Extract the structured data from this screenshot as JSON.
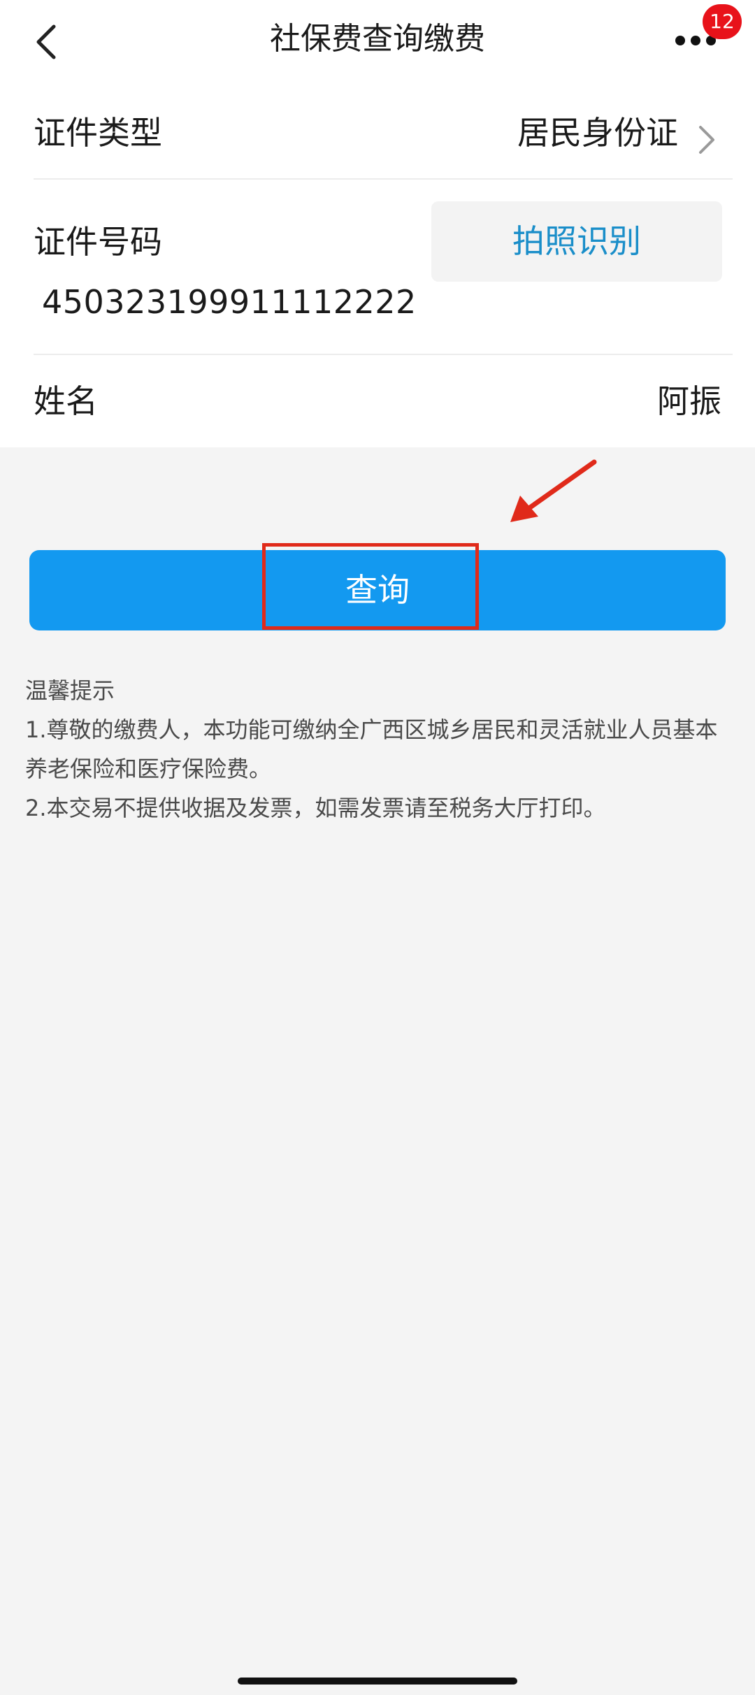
{
  "nav": {
    "title": "社保费查询缴费",
    "badge_count": "12",
    "back_icon": "chevron-left-icon",
    "more_icon": "more-dots-icon"
  },
  "form": {
    "id_type_label": "证件类型",
    "id_type_value": "居民身份证",
    "id_number_label": "证件号码",
    "photo_button_label": "拍照识别",
    "id_number_value": "450323199911112222",
    "name_label": "姓名",
    "name_value": "阿振"
  },
  "query_button_label": "查询",
  "tips": {
    "title": "温馨提示",
    "line1": "1.尊敬的缴费人，本功能可缴纳全广西区城乡居民和灵活就业人员基本养老保险和医疗保险费。",
    "line2": "2.本交易不提供收据及发票，如需发票请至税务大厅打印。"
  },
  "colors": {
    "primary": "#1399f0",
    "link": "#1a8ec9",
    "badge": "#e8121a",
    "annotation": "#e02a1a"
  }
}
